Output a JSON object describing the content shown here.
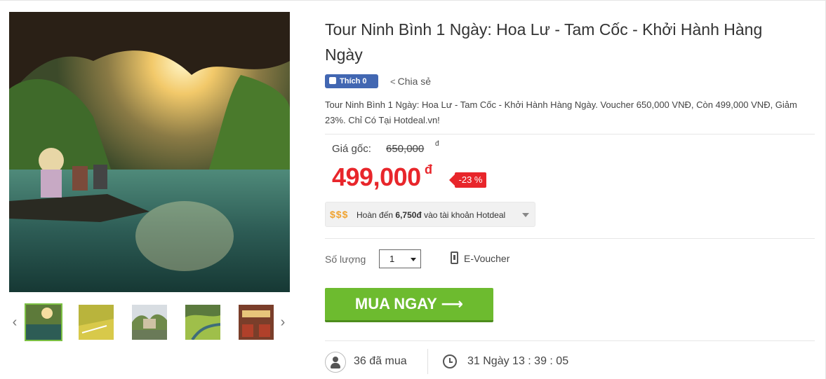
{
  "product": {
    "title": "Tour Ninh Bình 1 Ngày: Hoa Lư - Tam Cốc - Khởi Hành Hàng Ngày",
    "description": "Tour Ninh Bình 1 Ngày: Hoa Lư - Tam Cốc - Khởi Hành Hàng Ngày. Voucher 650,000 VNĐ, Còn 499,000 VNĐ, Giảm 23%. Chỉ Có Tại Hotdeal.vn!"
  },
  "social": {
    "like_label": "Thích 0",
    "share_label": "Chia sẻ"
  },
  "price": {
    "original_label": "Giá gốc:",
    "original_value": "650,000",
    "original_currency": "đ",
    "sale_value": "499,000",
    "sale_currency": "đ",
    "discount": "-23 %"
  },
  "cashback": {
    "icon": "$$$",
    "text_prefix": "Hoàn đến ",
    "amount": "6,750đ",
    "text_suffix": " vào tài khoản Hotdeal"
  },
  "purchase": {
    "quantity_label": "Số lượng",
    "quantity_value": "1",
    "voucher_type": "E-Voucher",
    "buy_label": "MUA NGAY ⟶"
  },
  "stats": {
    "buyers": "36 đã mua",
    "countdown": "31 Ngày 13 : 39 : 05"
  },
  "gallery": {
    "thumbnail_count": 5,
    "active_index": 0,
    "prev_icon": "chevron-left-icon",
    "next_icon": "chevron-right-icon"
  },
  "colors": {
    "sale_red": "#e8262b",
    "buy_green": "#6dbb2f",
    "facebook_blue": "#4267b2",
    "active_thumb_border": "#7cc043",
    "cashback_gold": "#f0a330"
  }
}
